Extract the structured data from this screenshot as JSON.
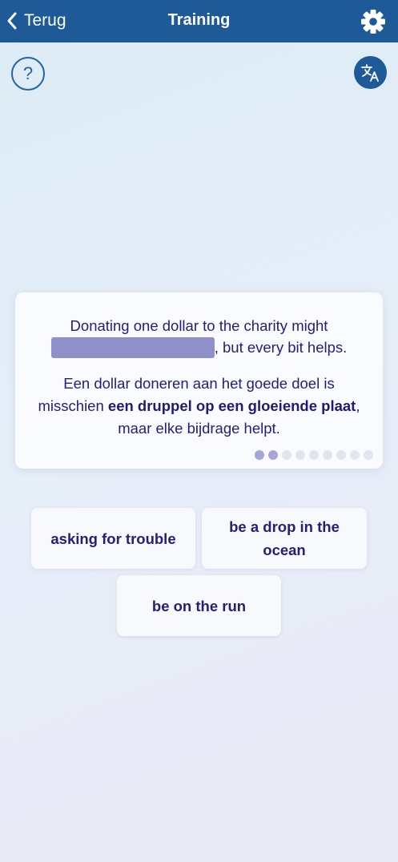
{
  "header": {
    "back_label": "Terug",
    "title": "Training",
    "color": "#1d5a97"
  },
  "help": {
    "label": "?"
  },
  "exercise": {
    "sentence_before_blank": "Donating one dollar to the charity might",
    "sentence_after_blank": ", but every bit helps.",
    "translation_start": "Een dollar doneren aan het goede doel is misschien ",
    "translation_bold": "een druppel op een gloeiende plaat",
    "translation_end": ", maar elke bijdrage helpt.",
    "progress": {
      "completed": 2,
      "total": 9
    }
  },
  "options": [
    {
      "label": "asking for trouble"
    },
    {
      "label": "be a drop in the ocean"
    },
    {
      "label": "be on the run"
    }
  ],
  "icons": {
    "back": "chevron-left-icon",
    "settings": "gear-icon",
    "help": "question-icon",
    "translate": "translate-icon"
  }
}
